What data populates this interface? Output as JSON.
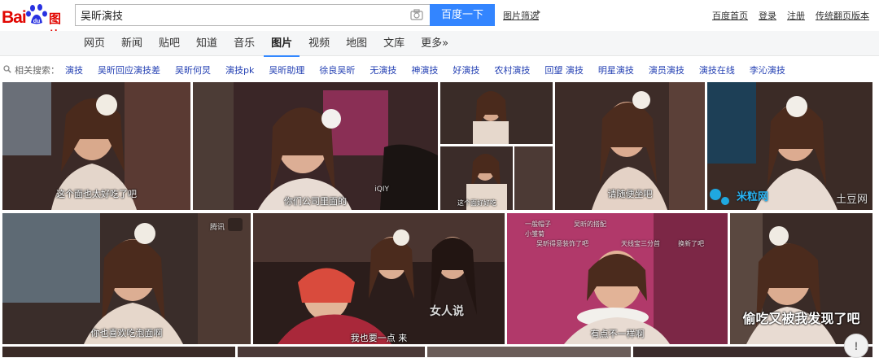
{
  "logo": {
    "text_bai": "Bai",
    "text_tupian": "图片"
  },
  "search": {
    "query": "吴昕演技",
    "button_label": "百度一下"
  },
  "filter_link": "图片筛选",
  "top_links": [
    "百度首页",
    "登录",
    "注册",
    "传统翻页版本"
  ],
  "nav_tabs": [
    "网页",
    "新闻",
    "贴吧",
    "知道",
    "音乐",
    "图片",
    "视频",
    "地图",
    "文库",
    "更多»"
  ],
  "active_tab": "图片",
  "related": {
    "label": "相关搜索：",
    "items": [
      "演技",
      "吴昕回应演技差",
      "吴昕何炅",
      "演技pk",
      "吴昕助理",
      "徐良吴昕",
      "无演技",
      "神演技",
      "好演技",
      "农村演技",
      "回望 演技",
      "明星演技",
      "演员演技",
      "演技在线",
      "李沁演技"
    ]
  },
  "thumbs": [
    {
      "caption": "这个面也太好吃了吧",
      "watermark": ""
    },
    {
      "caption": "你们公司里面的",
      "watermark": "iQIY"
    },
    {
      "caption": "",
      "watermark": ""
    },
    {
      "caption": "请随便坐吧",
      "watermark": ""
    },
    {
      "caption": "",
      "watermark": ""
    },
    {
      "caption": "你也喜欢吃泡面啊",
      "watermark": "腾讯"
    },
    {
      "caption": "我也要一点  来",
      "watermark": "女人说"
    },
    {
      "caption": "有点不一样啊",
      "watermark": ""
    },
    {
      "caption": "偷吃又被我发现了吧",
      "watermark": ""
    }
  ],
  "thumb_text": {
    "t3_small_caption": "这个面好好吃",
    "t5_logo": "米粒网",
    "t5_logo_right": "土豆网",
    "t8_lines": [
      "一般帽子",
      "吴昕的搭配",
      "小雏菊",
      "吴昕得意装饰了吧",
      "天线宝三分首",
      "换新了吧"
    ]
  },
  "feedback": "!"
}
